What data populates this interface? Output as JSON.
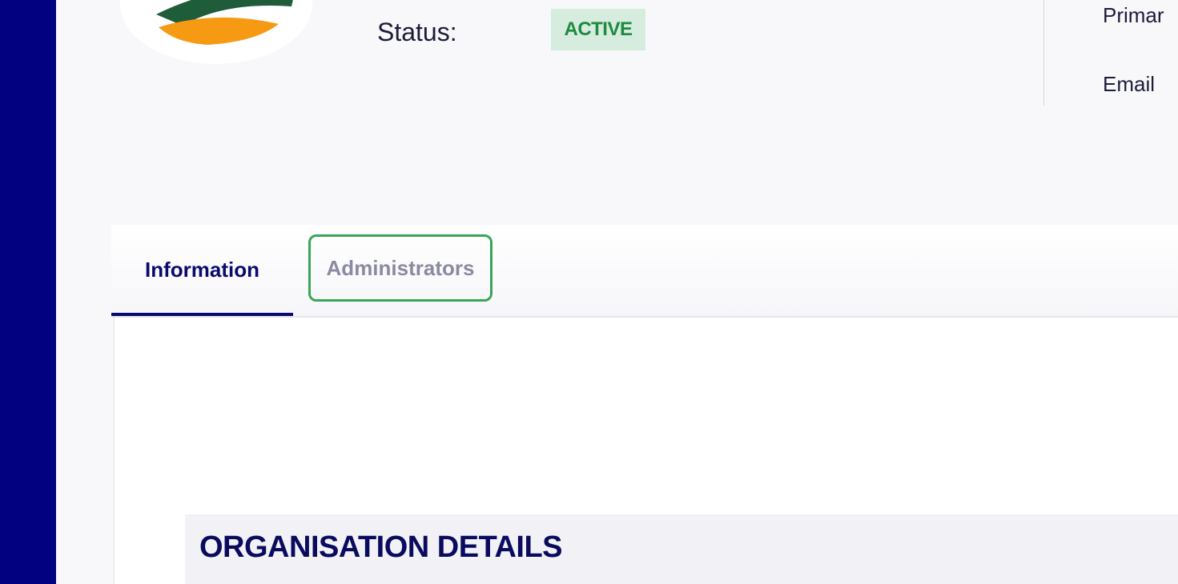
{
  "sidebar": {},
  "header": {
    "status_label": "Status:",
    "status_value": "ACTIVE",
    "contact": {
      "primary_label": "Primar",
      "email_label": "Email"
    }
  },
  "tabs": [
    {
      "label": "Information",
      "active": true
    },
    {
      "label": "Administrators",
      "active": false
    }
  ],
  "content": {
    "section_title": "ORGANISATION DETAILS"
  },
  "colors": {
    "sidebar": "#020280",
    "active_tab": "#0a0a6e",
    "status_bg": "#d5ecdf",
    "status_text": "#1e8a3e",
    "highlight_border": "#3aa559",
    "logo_green": "#1f5c3a",
    "logo_orange": "#f59a12"
  },
  "icons": {
    "logo": "organisation-logo"
  }
}
